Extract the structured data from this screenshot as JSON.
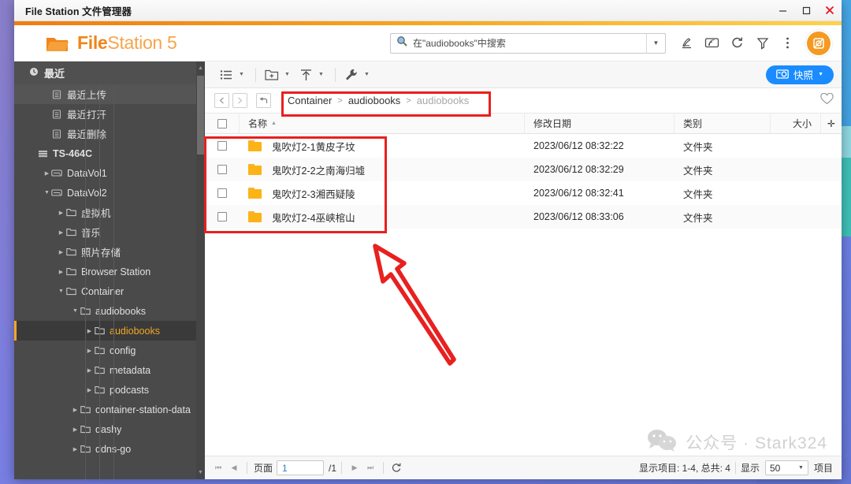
{
  "window": {
    "title": "File Station 文件管理器",
    "controls": {
      "minimize": "minimize-icon",
      "maximize": "maximize-icon",
      "close": "close-icon"
    }
  },
  "app_header": {
    "brand_bold": "File",
    "brand_light": "Station 5",
    "logo_icon": "folder-logo-icon",
    "search": {
      "value": "在\"audiobooks\"中搜索",
      "icon": "search-icon",
      "caret": "▼"
    },
    "icons": [
      {
        "name": "signature-icon",
        "glyph": "signature"
      },
      {
        "name": "cast-screen-icon",
        "glyph": "cast"
      },
      {
        "name": "refresh-icon",
        "glyph": "refresh"
      },
      {
        "name": "filter-icon",
        "glyph": "filter"
      },
      {
        "name": "more-vertical-icon",
        "glyph": "kebab"
      }
    ],
    "avatar": "user-avatar-icon"
  },
  "sidebar": {
    "recent_section": {
      "label": "最近",
      "icon": "clock-icon"
    },
    "items": [
      {
        "label": "最近上传",
        "icon": "doc-icon",
        "depth": 1,
        "twisty": "",
        "state": "highlight"
      },
      {
        "label": "最近打开",
        "icon": "doc-icon",
        "depth": 1,
        "twisty": "",
        "state": ""
      },
      {
        "label": "最近删除",
        "icon": "doc-icon",
        "depth": 1,
        "twisty": "",
        "state": ""
      },
      {
        "label": "TS-464C",
        "icon": "nas-icon",
        "depth": 0,
        "twisty": "",
        "state": "bold"
      },
      {
        "label": "DataVol1",
        "icon": "volume-icon",
        "depth": 1,
        "twisty": "collapsed",
        "state": ""
      },
      {
        "label": "DataVol2",
        "icon": "volume-icon",
        "depth": 1,
        "twisty": "expanded",
        "state": ""
      },
      {
        "label": "虚拟机",
        "icon": "folder-outline-icon",
        "depth": 2,
        "twisty": "collapsed",
        "state": ""
      },
      {
        "label": "音乐",
        "icon": "folder-outline-icon",
        "depth": 2,
        "twisty": "collapsed",
        "state": ""
      },
      {
        "label": "照片存储",
        "icon": "folder-outline-icon",
        "depth": 2,
        "twisty": "collapsed",
        "state": ""
      },
      {
        "label": "Browser Station",
        "icon": "folder-outline-icon",
        "depth": 2,
        "twisty": "collapsed",
        "state": ""
      },
      {
        "label": "Container",
        "icon": "folder-outline-icon",
        "depth": 2,
        "twisty": "expanded",
        "state": ""
      },
      {
        "label": "audiobooks",
        "icon": "folder-outline-icon",
        "depth": 3,
        "twisty": "expanded",
        "state": ""
      },
      {
        "label": "audiobooks",
        "icon": "folder-outline-icon",
        "depth": 4,
        "twisty": "collapsed",
        "state": "selected"
      },
      {
        "label": "config",
        "icon": "folder-outline-icon",
        "depth": 4,
        "twisty": "collapsed",
        "state": ""
      },
      {
        "label": "metadata",
        "icon": "folder-outline-icon",
        "depth": 4,
        "twisty": "collapsed",
        "state": ""
      },
      {
        "label": "podcasts",
        "icon": "folder-outline-icon",
        "depth": 4,
        "twisty": "collapsed",
        "state": ""
      },
      {
        "label": "container-station-data",
        "icon": "folder-outline-icon",
        "depth": 3,
        "twisty": "collapsed",
        "state": ""
      },
      {
        "label": "dashy",
        "icon": "folder-outline-icon",
        "depth": 3,
        "twisty": "collapsed",
        "state": ""
      },
      {
        "label": "ddns-go",
        "icon": "folder-outline-icon",
        "depth": 3,
        "twisty": "collapsed",
        "state": ""
      }
    ]
  },
  "file_toolbar": {
    "buttons": [
      {
        "name": "view-mode-button",
        "icon": "list-view-icon",
        "caret": "▼"
      },
      {
        "name": "create-folder-button",
        "icon": "new-folder-icon",
        "caret": "▼"
      },
      {
        "name": "upload-button",
        "icon": "upload-icon",
        "caret": "▼"
      },
      {
        "name": "tools-button",
        "icon": "wrench-icon",
        "caret": "▼"
      }
    ],
    "snapshot": {
      "label": "快照",
      "icon": "camera-icon",
      "caret": "▼",
      "color": "#1a8cff"
    }
  },
  "breadcrumb": {
    "back": "◀",
    "forward": "▶",
    "up": "↰",
    "separator": ">",
    "path": [
      {
        "label": "Container",
        "dim": false
      },
      {
        "label": "audiobooks",
        "dim": false
      },
      {
        "label": "audiobooks",
        "dim": true
      }
    ],
    "favorite_icon": "heart-icon"
  },
  "file_list": {
    "columns": [
      {
        "key": "check",
        "label": ""
      },
      {
        "key": "name",
        "label": "名称",
        "sort": "▲"
      },
      {
        "key": "date",
        "label": "修改日期"
      },
      {
        "key": "type",
        "label": "类别"
      },
      {
        "key": "size",
        "label": "大小"
      },
      {
        "key": "add",
        "label": "✛"
      }
    ],
    "rows": [
      {
        "name": "鬼吹灯2-1黄皮子坟",
        "date": "2023/06/12 08:32:22",
        "type": "文件夹",
        "size": "",
        "icon": "folder-icon"
      },
      {
        "name": "鬼吹灯2-2之南海归墟",
        "date": "2023/06/12 08:32:29",
        "type": "文件夹",
        "size": "",
        "icon": "folder-icon"
      },
      {
        "name": "鬼吹灯2-3湘西疑陵",
        "date": "2023/06/12 08:32:41",
        "type": "文件夹",
        "size": "",
        "icon": "folder-icon"
      },
      {
        "name": "鬼吹灯2-4巫峡棺山",
        "date": "2023/06/12 08:33:06",
        "type": "文件夹",
        "size": "",
        "icon": "folder-icon"
      }
    ]
  },
  "status_bar": {
    "first_page": "⏮",
    "prev_page": "◀",
    "page_label": "页面",
    "page_value": "1",
    "page_total": "/1",
    "next_page": "▶",
    "last_page": "⏭",
    "refresh_icon": "refresh-icon",
    "items_info": "显示项目: 1-4, 总共: 4",
    "show_label": "显示",
    "show_value": "50",
    "show_caret": "▼",
    "items_suffix": "项目"
  },
  "watermark": {
    "text": "公众号 · Stark324",
    "icon": "wechat-icon"
  },
  "annotations": {
    "breadcrumb_box": "red-highlight-rectangle",
    "rows_box": "red-highlight-rectangle",
    "arrow": "red-arrow-pointing-up-left",
    "color": "#e8201f"
  }
}
